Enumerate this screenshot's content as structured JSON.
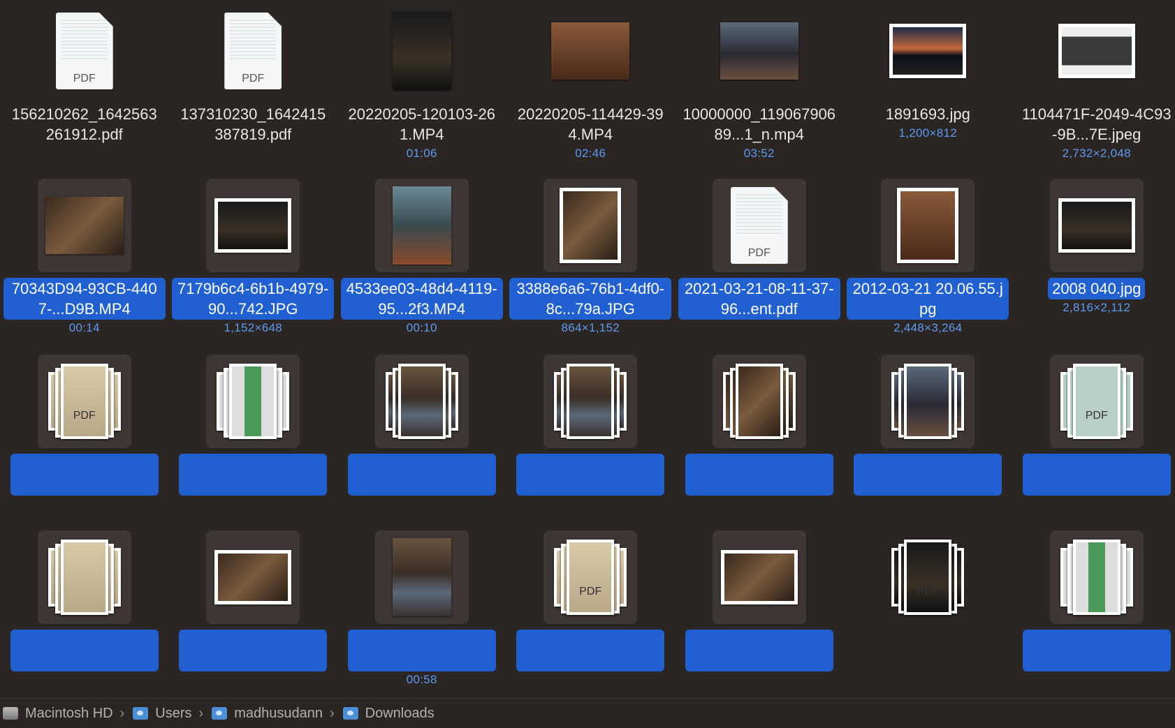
{
  "files": [
    {
      "name": "156210262_1642563261912.pdf",
      "meta": "",
      "kind": "pdf",
      "row": 0
    },
    {
      "name": "137310230_1642415387819.pdf",
      "meta": "",
      "kind": "pdf",
      "row": 0
    },
    {
      "name": "20220205-120103-261.MP4",
      "meta": "01:06",
      "kind": "video-p",
      "art": "g-dark",
      "row": 0
    },
    {
      "name": "20220205-114429-394.MP4",
      "meta": "02:46",
      "kind": "video-l",
      "art": "g-brown",
      "row": 0
    },
    {
      "name": "10000000_11906790689...1_n.mp4",
      "meta": "03:52",
      "kind": "video-l",
      "art": "g-crowd",
      "row": 0
    },
    {
      "name": "1891693.jpg",
      "meta": "1,200×812",
      "kind": "framed-l",
      "art": "g-city",
      "row": 0
    },
    {
      "name": "1104471F-2049-4C93-9B...7E.jpeg",
      "meta": "2,732×2,048",
      "kind": "framed-l",
      "art": "g-house",
      "row": 0
    },
    {
      "name": "70343D94-93CB-4407-...D9B.MP4",
      "meta": "00:14",
      "kind": "video-l",
      "art": "g-room",
      "row": 1,
      "selected": true
    },
    {
      "name": "7179b6c4-6b1b-4979-90...742.JPG",
      "meta": "1,152×648",
      "kind": "framed-l",
      "art": "g-dark",
      "row": 1,
      "selected": true
    },
    {
      "name": "4533ee03-48d4-4119-95...2f3.MP4",
      "meta": "00:10",
      "kind": "video-p",
      "art": "g-water",
      "row": 1,
      "selected": true
    },
    {
      "name": "3388e6a6-76b1-4df0-8c...79a.JPG",
      "meta": "864×1,152",
      "kind": "framed-p",
      "art": "g-room",
      "row": 1,
      "selected": true
    },
    {
      "name": "2021-03-21-08-11-37-96...ent.pdf",
      "meta": "",
      "kind": "pdf",
      "row": 1,
      "selected": true
    },
    {
      "name": "2012-03-21 20.06.55.jpg",
      "meta": "2,448×3,264",
      "kind": "framed-p",
      "art": "g-brown",
      "row": 1,
      "selected": true
    },
    {
      "name": "2008 040.jpg",
      "meta": "2,816×2,112",
      "kind": "framed-l",
      "art": "g-dark",
      "row": 1,
      "selected": true
    },
    {
      "name": "",
      "meta": "",
      "kind": "stack-pdf",
      "art": "g-tan",
      "row": 2,
      "selected": true
    },
    {
      "name": "",
      "meta": "",
      "kind": "stack",
      "art": "g-green",
      "row": 2,
      "selected": true
    },
    {
      "name": "",
      "meta": "",
      "kind": "stack",
      "art": "g-person",
      "row": 2,
      "selected": true
    },
    {
      "name": "",
      "meta": "",
      "kind": "stack",
      "art": "g-person",
      "row": 2,
      "selected": true
    },
    {
      "name": "",
      "meta": "",
      "kind": "stack",
      "art": "g-room",
      "row": 2,
      "selected": true
    },
    {
      "name": "",
      "meta": "",
      "kind": "stack",
      "art": "g-crowd",
      "row": 2,
      "selected": true
    },
    {
      "name": "",
      "meta": "",
      "kind": "stack-pdf",
      "art": "g-teal",
      "row": 2,
      "selected": true
    },
    {
      "name": "",
      "meta": "",
      "kind": "stack",
      "art": "g-tan",
      "row": 3,
      "selected": true
    },
    {
      "name": "",
      "meta": "",
      "kind": "framed-l",
      "art": "g-room",
      "row": 3,
      "selected": true
    },
    {
      "name": "",
      "meta": "00:58",
      "kind": "video-p",
      "art": "g-person",
      "row": 3,
      "selected": true
    },
    {
      "name": "",
      "meta": "",
      "kind": "stack-pdf",
      "art": "g-tan",
      "row": 3,
      "selected": true
    },
    {
      "name": "",
      "meta": "",
      "kind": "framed-l",
      "art": "g-room",
      "row": 3,
      "selected": true
    },
    {
      "name": "",
      "meta": "",
      "kind": "stack-pdf",
      "art": "g-dark",
      "row": 3,
      "selected": false
    },
    {
      "name": "",
      "meta": "",
      "kind": "stack",
      "art": "g-green",
      "row": 3,
      "selected": true
    }
  ],
  "breadcrumb": [
    {
      "label": "Macintosh HD",
      "icon": "hard-drive-icon"
    },
    {
      "label": "Users",
      "icon": "folder-icon"
    },
    {
      "label": "madhusudann",
      "icon": "home-folder-icon"
    },
    {
      "label": "Downloads",
      "icon": "folder-icon"
    }
  ],
  "colors": {
    "selection": "#2060d0",
    "background": "#2b2523",
    "meta": "#5d9bf0"
  }
}
